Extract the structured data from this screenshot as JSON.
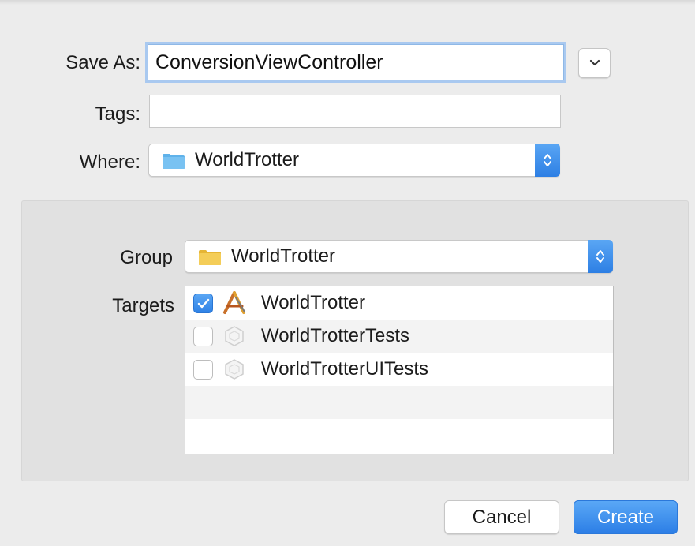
{
  "save_as": {
    "label": "Save As:",
    "value": "ConversionViewController"
  },
  "tags": {
    "label": "Tags:",
    "value": ""
  },
  "where": {
    "label": "Where:",
    "value": "WorldTrotter",
    "folder_color": "#5fb2ea"
  },
  "group": {
    "label": "Group",
    "value": "WorldTrotter",
    "folder_color": "#f2c84a"
  },
  "targets": {
    "label": "Targets",
    "items": [
      {
        "name": "WorldTrotter",
        "checked": true,
        "icon": "app-target-icon"
      },
      {
        "name": "WorldTrotterTests",
        "checked": false,
        "icon": "test-target-icon"
      },
      {
        "name": "WorldTrotterUITests",
        "checked": false,
        "icon": "test-target-icon"
      }
    ]
  },
  "buttons": {
    "cancel": "Cancel",
    "create": "Create"
  },
  "colors": {
    "accent": "#2f82e6",
    "window_background": "#ececec",
    "panel_background": "#e1e1e1"
  }
}
